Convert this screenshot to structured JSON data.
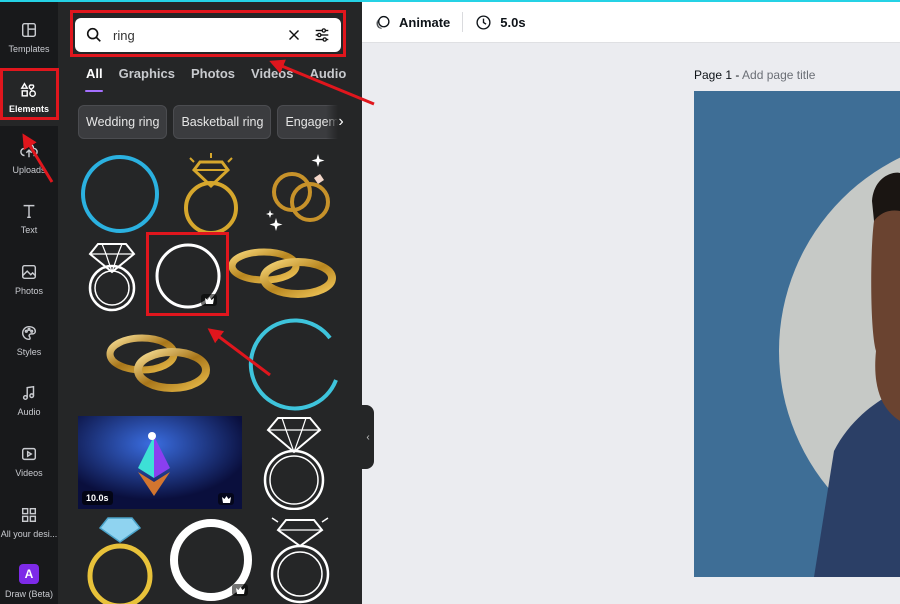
{
  "rail": {
    "items": [
      {
        "label": "Templates",
        "icon": "templates-icon"
      },
      {
        "label": "Elements",
        "icon": "elements-icon"
      },
      {
        "label": "Uploads",
        "icon": "uploads-icon"
      },
      {
        "label": "Text",
        "icon": "text-icon"
      },
      {
        "label": "Photos",
        "icon": "photos-icon"
      },
      {
        "label": "Styles",
        "icon": "styles-icon"
      },
      {
        "label": "Audio",
        "icon": "audio-icon"
      },
      {
        "label": "Videos",
        "icon": "videos-icon"
      },
      {
        "label": "All your desi...",
        "icon": "all-designs-icon"
      },
      {
        "label": "Draw (Beta)",
        "icon": "draw-icon",
        "badge": "A"
      }
    ],
    "active": "Elements"
  },
  "search": {
    "value": "ring"
  },
  "tabs": [
    "All",
    "Graphics",
    "Photos",
    "Videos",
    "Audio"
  ],
  "active_tab": "All",
  "chips": [
    "Wedding ring",
    "Basketball ring",
    "Engagem"
  ],
  "results": {
    "video_duration": "10.0s"
  },
  "toolbar": {
    "animate_label": "Animate",
    "duration_label": "5.0s"
  },
  "canvas": {
    "page_label": "Page 1 -",
    "page_title_placeholder": "Add page title"
  },
  "colors": {
    "accent_top": "#25d2e5",
    "annotation_red": "#e0161d",
    "page_background": "#3e6e96",
    "tab_underline": "#a570ff"
  }
}
